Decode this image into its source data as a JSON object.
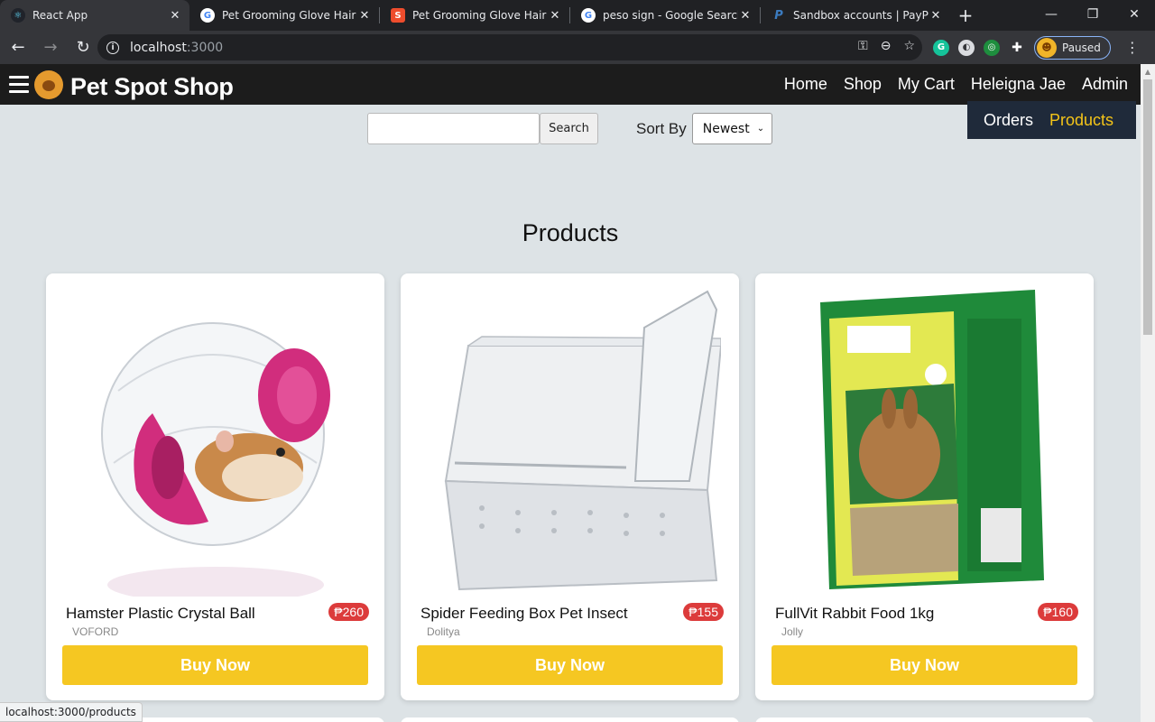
{
  "browser": {
    "tabs": [
      {
        "title": "React App",
        "active": true,
        "icon": "react-icon"
      },
      {
        "title": "Pet Grooming Glove Hair Re",
        "active": false,
        "icon": "google-icon"
      },
      {
        "title": "Pet Grooming Glove Hair Re",
        "active": false,
        "icon": "shopee-icon"
      },
      {
        "title": "peso sign - Google Search",
        "active": false,
        "icon": "google-icon"
      },
      {
        "title": "Sandbox accounts | PayPal D",
        "active": false,
        "icon": "paypal-icon"
      }
    ],
    "url_host": "localhost",
    "url_port": ":3000",
    "profile_label": "Paused",
    "status_url": "localhost:3000/products"
  },
  "nav": {
    "brand": "Pet Spot Shop",
    "links": [
      "Home",
      "Shop",
      "My Cart",
      "Heleigna Jae",
      "Admin"
    ],
    "admin_menu": [
      "Orders",
      "Products"
    ]
  },
  "search": {
    "button": "Search",
    "sort_label": "Sort By",
    "sort_value": "Newest"
  },
  "page_title": "Products",
  "products": [
    {
      "name": "Hamster Plastic Crystal Ball",
      "price": "₱260",
      "brand": "VOFORD",
      "button": "Buy Now"
    },
    {
      "name": "Spider Feeding Box Pet Insect",
      "price": "₱155",
      "brand": "Dolitya",
      "button": "Buy Now"
    },
    {
      "name": "FullVit Rabbit Food 1kg",
      "price": "₱160",
      "brand": "Jolly",
      "button": "Buy Now"
    }
  ],
  "colors": {
    "accent": "#f5c722",
    "price_badge": "#dc3b3b",
    "navbar": "#1c1c1c",
    "admin_menu_bg": "#1f2a3a",
    "page_bg": "#dde3e6"
  }
}
